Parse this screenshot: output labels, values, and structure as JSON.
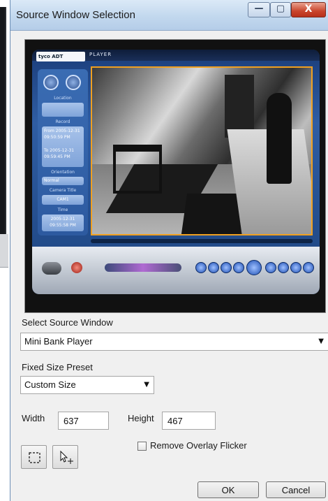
{
  "window": {
    "title": "Source Window Selection",
    "controls": {
      "minimize_glyph": "—",
      "maximize_glyph": "▢",
      "close_glyph": "X"
    }
  },
  "preview": {
    "player_logo": "tyco ADT",
    "player_title": "PLAYER",
    "side_panel": {
      "location_label": "Location",
      "record_label": "Record",
      "from_label": "From",
      "from_value": "2005-12-31 09:50:59 PM",
      "to_label": "To",
      "to_value": "2005-12-31 09:59:45 PM",
      "orientation_label": "Orientation",
      "orientation_value": "Normal",
      "camera_title_label": "Camera Title",
      "camera_title_value": "CAM1",
      "time_label": "Time",
      "time_value": "2005-12-31 09:55:58 PM"
    },
    "highlight_color": "#f0a020"
  },
  "form": {
    "source_label": "Select Source Window",
    "source_value": "Mini Bank Player",
    "preset_label": "Fixed Size Preset",
    "preset_value": "Custom Size",
    "width_label": "Width",
    "width_value": "637",
    "height_label": "Height",
    "height_value": "467",
    "overlay_label": "Remove Overlay Flicker",
    "overlay_checked": false
  },
  "buttons": {
    "ok": "OK",
    "cancel": "Cancel"
  },
  "icons": {
    "select_region": "dashed-rectangle-icon",
    "pick_window": "cursor-crosshair-icon",
    "dropdown": "chevron-down-icon"
  }
}
